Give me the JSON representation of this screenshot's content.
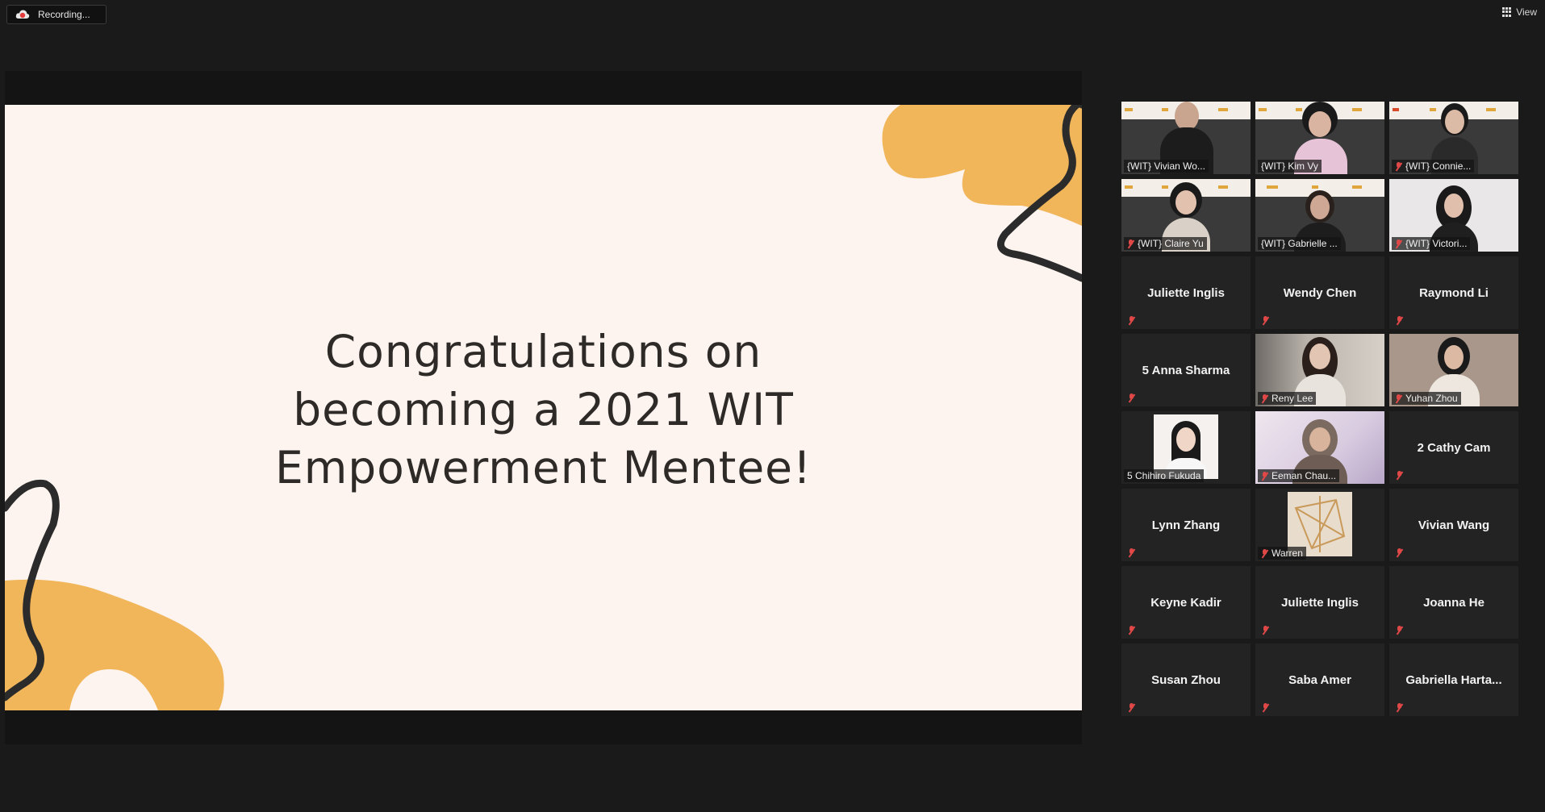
{
  "app": {
    "recording_label": "Recording...",
    "view_label": "View"
  },
  "slide": {
    "title_lines": [
      "Congratulations on",
      "becoming a 2021 WIT",
      "Empowerment Mentee!"
    ],
    "accent_color": "#f1b55a",
    "background_color": "#fdf4ef"
  },
  "participants": [
    {
      "name": "{WIT} Vivian Wo...",
      "type": "video",
      "muted": false
    },
    {
      "name": "{WIT} Kim Vy",
      "type": "video",
      "muted": false
    },
    {
      "name": "{WIT} Connie...",
      "type": "video",
      "muted": true
    },
    {
      "name": "{WIT} Claire Yu",
      "type": "video",
      "muted": true
    },
    {
      "name": "{WIT} Gabrielle ...",
      "type": "video",
      "muted": false,
      "active_speaker": true
    },
    {
      "name": "{WIT} Victori...",
      "type": "video",
      "muted": true
    },
    {
      "name": "Juliette Inglis",
      "type": "name",
      "muted": true
    },
    {
      "name": "Wendy Chen",
      "type": "name",
      "muted": true
    },
    {
      "name": "Raymond Li",
      "type": "name",
      "muted": true
    },
    {
      "name": "5 Anna Sharma",
      "type": "name",
      "muted": true
    },
    {
      "name": "Reny Lee",
      "type": "video",
      "muted": true
    },
    {
      "name": "Yuhan Zhou",
      "type": "video",
      "muted": true
    },
    {
      "name": "5 Chihiro Fukuda",
      "type": "photo",
      "muted": false
    },
    {
      "name": "Eeman Chau...",
      "type": "video",
      "muted": true
    },
    {
      "name": "2 Cathy Cam",
      "type": "name",
      "muted": true
    },
    {
      "name": "Lynn Zhang",
      "type": "name",
      "muted": true
    },
    {
      "name": "Warren",
      "type": "photo",
      "muted": true
    },
    {
      "name": "Vivian Wang",
      "type": "name",
      "muted": true
    },
    {
      "name": "Keyne Kadir",
      "type": "name",
      "muted": true
    },
    {
      "name": "Juliette Inglis",
      "type": "name",
      "muted": true
    },
    {
      "name": "Joanna He",
      "type": "name",
      "muted": true
    },
    {
      "name": "Susan Zhou",
      "type": "name",
      "muted": true
    },
    {
      "name": "Saba Amer",
      "type": "name",
      "muted": true
    },
    {
      "name": "Gabriella  Harta...",
      "type": "name",
      "muted": true
    }
  ]
}
